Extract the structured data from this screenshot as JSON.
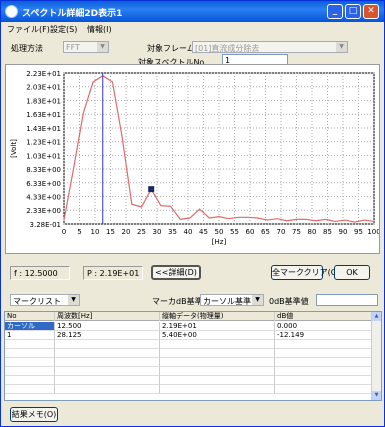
{
  "window": {
    "title": "スペクトル詳細2D表示1"
  },
  "menu": {
    "file": "ファイル(F)",
    "settings": "設定(S)",
    "info": "情報(I)"
  },
  "params": {
    "method_label": "処理方法",
    "method_value": "FFT",
    "frame_label": "対象フレーム",
    "frame_value": "[01]直流成分除去",
    "specno_label": "対象スペクトルNo",
    "specno_value": "1"
  },
  "chart_data": {
    "type": "line",
    "xlabel": "[Hz]",
    "ylabel": "[Volt]",
    "xlim": [
      0,
      100
    ],
    "ylim": [
      0.328,
      22.3
    ],
    "y_ticks": [
      "2.23E+01",
      "2.03E+01",
      "1.83E+01",
      "1.63E+01",
      "1.43E+01",
      "1.23E+01",
      "1.03E+01",
      "8.33E+00",
      "6.33E+00",
      "4.33E+00",
      "2.33E+00",
      "3.28E-01"
    ],
    "y_tick_values": [
      22.3,
      20.3,
      18.3,
      16.3,
      14.3,
      12.3,
      10.3,
      8.33,
      6.33,
      4.33,
      2.33,
      0.328
    ],
    "x_ticks": [
      "0",
      "5",
      "10",
      "15",
      "20",
      "25",
      "30",
      "35",
      "40",
      "45",
      "50",
      "55",
      "60",
      "65",
      "70",
      "75",
      "80",
      "85",
      "90",
      "95",
      "100"
    ],
    "x": [
      0,
      3.125,
      6.25,
      9.375,
      12.5,
      15.625,
      18.75,
      21.875,
      25,
      28.125,
      31.25,
      34.375,
      37.5,
      40.625,
      43.75,
      46.875,
      50,
      53.125,
      56.25,
      59.375,
      62.5,
      65.625,
      68.75,
      71.875,
      75,
      78.125,
      81.25,
      84.375,
      87.5,
      90.625,
      93.75,
      96.875,
      100
    ],
    "y": [
      0.9,
      8.5,
      16.5,
      21.0,
      21.9,
      21.0,
      13.0,
      3.2,
      2.8,
      5.4,
      3.0,
      2.9,
      1.0,
      1.2,
      2.5,
      1.2,
      1.4,
      1.1,
      1.3,
      1.3,
      1.2,
      0.9,
      1.1,
      0.8,
      1.0,
      1.0,
      0.8,
      1.0,
      0.7,
      0.9,
      0.6,
      0.9,
      0.7
    ],
    "cursor_x": 12.5,
    "marker": {
      "x": 28.125,
      "y": 5.4
    },
    "line_color": "#e06a6a",
    "cursor_color": "#3333cc",
    "marker_color": "#1a2a66"
  },
  "status": {
    "freq": "f : 12.5000",
    "peak": "P : 2.19E+01"
  },
  "buttons": {
    "detail": "<<詳細(D)",
    "clear_markers": "全マーククリア(C)",
    "ok": "OK",
    "note": "結果メモ(O)"
  },
  "markers": {
    "list_value": "マークリスト",
    "db_ref_label": "マーカdB基準",
    "db_ref_value": "カーソル基準",
    "zero_db_label": "0dB基準値"
  },
  "table": {
    "headers": [
      "No",
      "周波数[Hz]",
      "縦軸データ(物理量)",
      "dB値"
    ],
    "rows": [
      [
        "カーソル",
        "12.500",
        "2.19E+01",
        "0.000"
      ],
      [
        "1",
        "28.125",
        "5.40E+00",
        "-12.149"
      ]
    ]
  }
}
